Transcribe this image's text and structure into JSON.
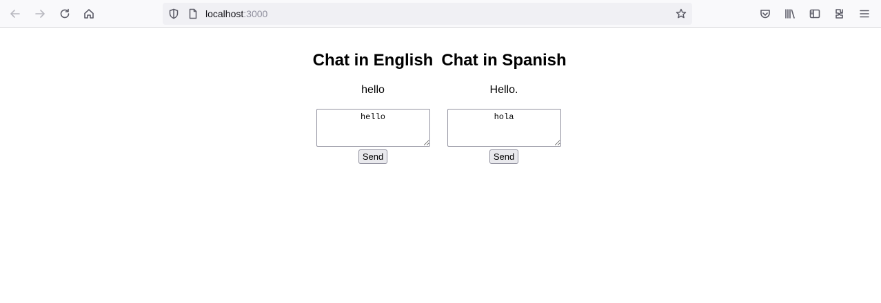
{
  "browser": {
    "url_host": "localhost",
    "url_port": ":3000",
    "icons": [
      "back-arrow-icon",
      "forward-arrow-icon",
      "reload-icon",
      "home-icon",
      "shield-icon",
      "page-icon",
      "bookmark-star-icon",
      "pocket-icon",
      "library-icon",
      "sidebar-icon",
      "extensions-icon",
      "menu-icon"
    ]
  },
  "chats": [
    {
      "title": "Chat in English",
      "message": "hello",
      "input_value": "hello",
      "send_label": "Send"
    },
    {
      "title": "Chat in Spanish",
      "message": "Hello.",
      "input_value": "hola",
      "send_label": "Send"
    }
  ]
}
